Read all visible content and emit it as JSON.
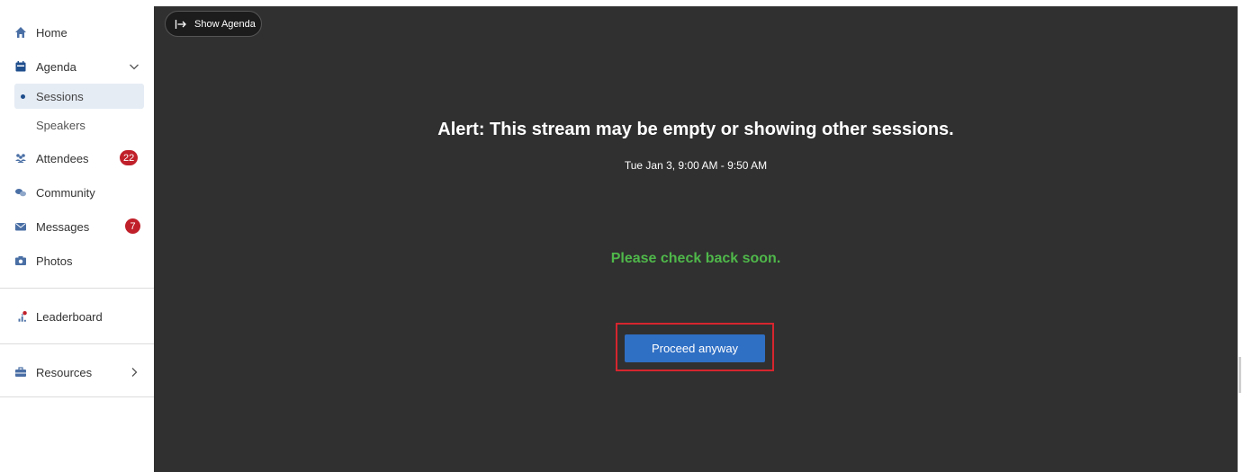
{
  "sidebar": {
    "home": "Home",
    "agenda": "Agenda",
    "sessions": "Sessions",
    "speakers": "Speakers",
    "attendees": "Attendees",
    "attendees_badge": "22",
    "community": "Community",
    "messages": "Messages",
    "messages_badge": "7",
    "photos": "Photos",
    "leaderboard": "Leaderboard",
    "resources": "Resources"
  },
  "main": {
    "show_agenda": "Show Agenda",
    "alert_title": "Alert: This stream may be empty or showing other sessions.",
    "time": "Tue Jan 3, 9:00 AM - 9:50 AM",
    "check_back": "Please check back soon.",
    "proceed_button": "Proceed anyway"
  },
  "colors": {
    "icon": "#4a6fa5",
    "badge": "#c0202a",
    "main_bg": "#303030",
    "success_text": "#4fb84a",
    "primary_button": "#2f6fc4",
    "highlight_border": "#d6252e"
  },
  "icons": [
    "home-icon",
    "calendar-icon",
    "chevron-down-icon",
    "attendees-icon",
    "community-icon",
    "mail-icon",
    "camera-icon",
    "leaderboard-icon",
    "briefcase-icon",
    "chevron-right-icon",
    "expand-arrow-icon"
  ]
}
